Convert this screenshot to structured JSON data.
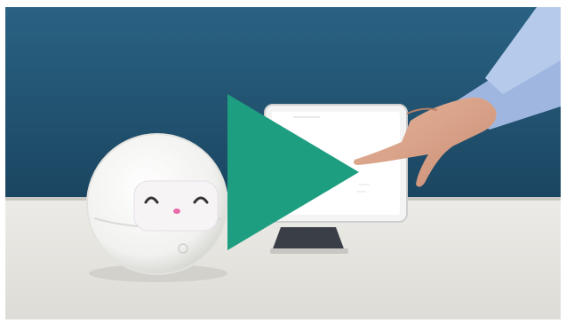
{
  "video": {
    "play_label": "",
    "accent_color": "#1e9e80",
    "play_icon": "play-icon",
    "wall_color": "#20506e",
    "table_color": "#e6e5e0"
  }
}
